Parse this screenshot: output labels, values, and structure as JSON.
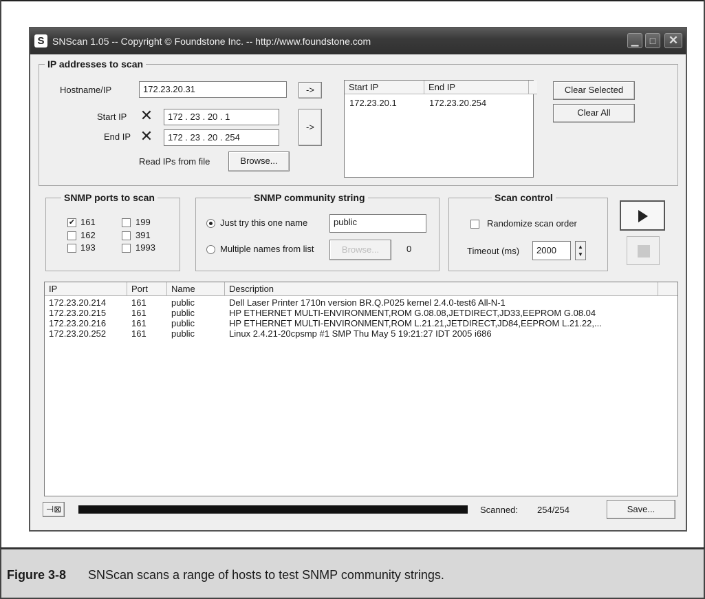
{
  "window": {
    "title": "SNScan 1.05 -- Copyright © Foundstone Inc. -- http://www.foundstone.com",
    "app_icon_letter": "S"
  },
  "ip_group": {
    "legend": "IP addresses to scan",
    "hostname_label": "Hostname/IP",
    "hostname_value": "172.23.20.31",
    "arrow_label": "->",
    "start_ip_label": "Start IP",
    "start_ip_value": "172 . 23 . 20 . 1",
    "end_ip_label": "End IP",
    "end_ip_value": "172 . 23 . 20 . 254",
    "read_ips_label": "Read IPs from file",
    "browse_label": "Browse...",
    "range_list": {
      "columns": [
        "Start IP",
        "End IP"
      ],
      "rows": [
        [
          "172.23.20.1",
          "172.23.20.254"
        ]
      ]
    },
    "clear_selected_label": "Clear Selected",
    "clear_all_label": "Clear All"
  },
  "ports_group": {
    "legend": "SNMP ports to scan",
    "ports": [
      {
        "label": "161",
        "checked": true
      },
      {
        "label": "199",
        "checked": false
      },
      {
        "label": "162",
        "checked": false
      },
      {
        "label": "391",
        "checked": false
      },
      {
        "label": "193",
        "checked": false
      },
      {
        "label": "1993",
        "checked": false
      }
    ]
  },
  "community_group": {
    "legend": "SNMP community string",
    "just_try_label": "Just try this one name",
    "name_value": "public",
    "multiple_label": "Multiple names from list",
    "browse_label": "Browse...",
    "count": "0"
  },
  "scan_group": {
    "legend": "Scan control",
    "randomize_label": "Randomize scan order",
    "timeout_label": "Timeout (ms)",
    "timeout_value": "2000"
  },
  "results": {
    "columns": [
      "IP",
      "Port",
      "Name",
      "Description"
    ],
    "rows": [
      [
        "172.23.20.214",
        "161",
        "public",
        "Dell Laser Printer 1710n version BR.Q.P025 kernel 2.4.0-test6 All-N-1"
      ],
      [
        "172.23.20.215",
        "161",
        "public",
        "HP ETHERNET MULTI-ENVIRONMENT,ROM G.08.08,JETDIRECT,JD33,EEPROM G.08.04"
      ],
      [
        "172.23.20.216",
        "161",
        "public",
        "HP ETHERNET MULTI-ENVIRONMENT,ROM L.21.21,JETDIRECT,JD84,EEPROM L.21.22,..."
      ],
      [
        "172.23.20.252",
        "161",
        "public",
        "Linux 2.4.21-20cpsmp #1 SMP Thu May 5 19:21:27 IDT 2005 i686"
      ]
    ]
  },
  "status": {
    "progress_fraction": 1.0,
    "scanned_label": "Scanned:",
    "scanned_value": "254/254",
    "save_label": "Save..."
  },
  "caption": {
    "number": "Figure 3-8",
    "text": "SNScan scans a range of hosts to test SNMP community strings."
  }
}
